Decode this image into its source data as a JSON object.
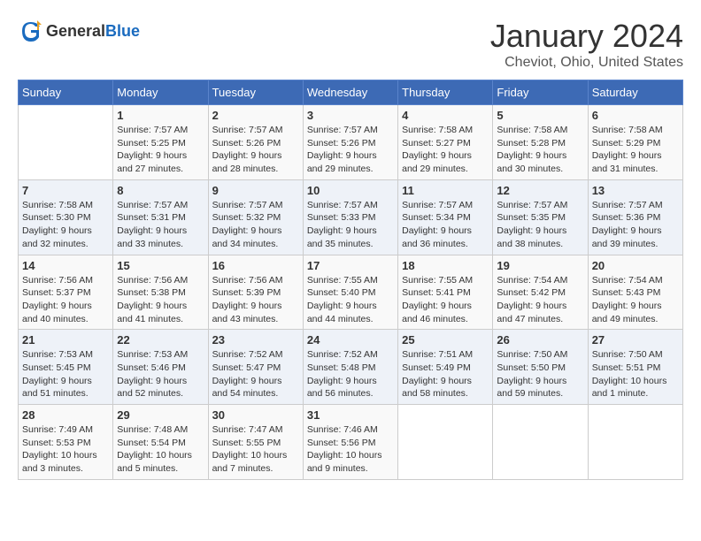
{
  "header": {
    "logo_general": "General",
    "logo_blue": "Blue",
    "title": "January 2024",
    "subtitle": "Cheviot, Ohio, United States"
  },
  "calendar": {
    "weekdays": [
      "Sunday",
      "Monday",
      "Tuesday",
      "Wednesday",
      "Thursday",
      "Friday",
      "Saturday"
    ],
    "weeks": [
      [
        {
          "day": "",
          "sunrise": "",
          "sunset": "",
          "daylight": ""
        },
        {
          "day": "1",
          "sunrise": "Sunrise: 7:57 AM",
          "sunset": "Sunset: 5:25 PM",
          "daylight": "Daylight: 9 hours and 27 minutes."
        },
        {
          "day": "2",
          "sunrise": "Sunrise: 7:57 AM",
          "sunset": "Sunset: 5:26 PM",
          "daylight": "Daylight: 9 hours and 28 minutes."
        },
        {
          "day": "3",
          "sunrise": "Sunrise: 7:57 AM",
          "sunset": "Sunset: 5:26 PM",
          "daylight": "Daylight: 9 hours and 29 minutes."
        },
        {
          "day": "4",
          "sunrise": "Sunrise: 7:58 AM",
          "sunset": "Sunset: 5:27 PM",
          "daylight": "Daylight: 9 hours and 29 minutes."
        },
        {
          "day": "5",
          "sunrise": "Sunrise: 7:58 AM",
          "sunset": "Sunset: 5:28 PM",
          "daylight": "Daylight: 9 hours and 30 minutes."
        },
        {
          "day": "6",
          "sunrise": "Sunrise: 7:58 AM",
          "sunset": "Sunset: 5:29 PM",
          "daylight": "Daylight: 9 hours and 31 minutes."
        }
      ],
      [
        {
          "day": "7",
          "sunrise": "Sunrise: 7:58 AM",
          "sunset": "Sunset: 5:30 PM",
          "daylight": "Daylight: 9 hours and 32 minutes."
        },
        {
          "day": "8",
          "sunrise": "Sunrise: 7:57 AM",
          "sunset": "Sunset: 5:31 PM",
          "daylight": "Daylight: 9 hours and 33 minutes."
        },
        {
          "day": "9",
          "sunrise": "Sunrise: 7:57 AM",
          "sunset": "Sunset: 5:32 PM",
          "daylight": "Daylight: 9 hours and 34 minutes."
        },
        {
          "day": "10",
          "sunrise": "Sunrise: 7:57 AM",
          "sunset": "Sunset: 5:33 PM",
          "daylight": "Daylight: 9 hours and 35 minutes."
        },
        {
          "day": "11",
          "sunrise": "Sunrise: 7:57 AM",
          "sunset": "Sunset: 5:34 PM",
          "daylight": "Daylight: 9 hours and 36 minutes."
        },
        {
          "day": "12",
          "sunrise": "Sunrise: 7:57 AM",
          "sunset": "Sunset: 5:35 PM",
          "daylight": "Daylight: 9 hours and 38 minutes."
        },
        {
          "day": "13",
          "sunrise": "Sunrise: 7:57 AM",
          "sunset": "Sunset: 5:36 PM",
          "daylight": "Daylight: 9 hours and 39 minutes."
        }
      ],
      [
        {
          "day": "14",
          "sunrise": "Sunrise: 7:56 AM",
          "sunset": "Sunset: 5:37 PM",
          "daylight": "Daylight: 9 hours and 40 minutes."
        },
        {
          "day": "15",
          "sunrise": "Sunrise: 7:56 AM",
          "sunset": "Sunset: 5:38 PM",
          "daylight": "Daylight: 9 hours and 41 minutes."
        },
        {
          "day": "16",
          "sunrise": "Sunrise: 7:56 AM",
          "sunset": "Sunset: 5:39 PM",
          "daylight": "Daylight: 9 hours and 43 minutes."
        },
        {
          "day": "17",
          "sunrise": "Sunrise: 7:55 AM",
          "sunset": "Sunset: 5:40 PM",
          "daylight": "Daylight: 9 hours and 44 minutes."
        },
        {
          "day": "18",
          "sunrise": "Sunrise: 7:55 AM",
          "sunset": "Sunset: 5:41 PM",
          "daylight": "Daylight: 9 hours and 46 minutes."
        },
        {
          "day": "19",
          "sunrise": "Sunrise: 7:54 AM",
          "sunset": "Sunset: 5:42 PM",
          "daylight": "Daylight: 9 hours and 47 minutes."
        },
        {
          "day": "20",
          "sunrise": "Sunrise: 7:54 AM",
          "sunset": "Sunset: 5:43 PM",
          "daylight": "Daylight: 9 hours and 49 minutes."
        }
      ],
      [
        {
          "day": "21",
          "sunrise": "Sunrise: 7:53 AM",
          "sunset": "Sunset: 5:45 PM",
          "daylight": "Daylight: 9 hours and 51 minutes."
        },
        {
          "day": "22",
          "sunrise": "Sunrise: 7:53 AM",
          "sunset": "Sunset: 5:46 PM",
          "daylight": "Daylight: 9 hours and 52 minutes."
        },
        {
          "day": "23",
          "sunrise": "Sunrise: 7:52 AM",
          "sunset": "Sunset: 5:47 PM",
          "daylight": "Daylight: 9 hours and 54 minutes."
        },
        {
          "day": "24",
          "sunrise": "Sunrise: 7:52 AM",
          "sunset": "Sunset: 5:48 PM",
          "daylight": "Daylight: 9 hours and 56 minutes."
        },
        {
          "day": "25",
          "sunrise": "Sunrise: 7:51 AM",
          "sunset": "Sunset: 5:49 PM",
          "daylight": "Daylight: 9 hours and 58 minutes."
        },
        {
          "day": "26",
          "sunrise": "Sunrise: 7:50 AM",
          "sunset": "Sunset: 5:50 PM",
          "daylight": "Daylight: 9 hours and 59 minutes."
        },
        {
          "day": "27",
          "sunrise": "Sunrise: 7:50 AM",
          "sunset": "Sunset: 5:51 PM",
          "daylight": "Daylight: 10 hours and 1 minute."
        }
      ],
      [
        {
          "day": "28",
          "sunrise": "Sunrise: 7:49 AM",
          "sunset": "Sunset: 5:53 PM",
          "daylight": "Daylight: 10 hours and 3 minutes."
        },
        {
          "day": "29",
          "sunrise": "Sunrise: 7:48 AM",
          "sunset": "Sunset: 5:54 PM",
          "daylight": "Daylight: 10 hours and 5 minutes."
        },
        {
          "day": "30",
          "sunrise": "Sunrise: 7:47 AM",
          "sunset": "Sunset: 5:55 PM",
          "daylight": "Daylight: 10 hours and 7 minutes."
        },
        {
          "day": "31",
          "sunrise": "Sunrise: 7:46 AM",
          "sunset": "Sunset: 5:56 PM",
          "daylight": "Daylight: 10 hours and 9 minutes."
        },
        {
          "day": "",
          "sunrise": "",
          "sunset": "",
          "daylight": ""
        },
        {
          "day": "",
          "sunrise": "",
          "sunset": "",
          "daylight": ""
        },
        {
          "day": "",
          "sunrise": "",
          "sunset": "",
          "daylight": ""
        }
      ]
    ]
  }
}
